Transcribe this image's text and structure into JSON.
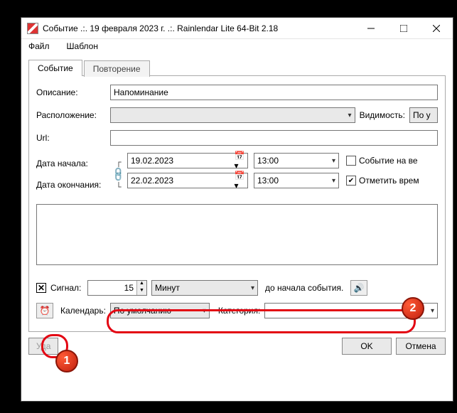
{
  "title": "Событие .:. 19 февраля 2023 г. .:. Rainlendar Lite 64-Bit 2.18",
  "menu": {
    "file": "Файл",
    "template": "Шаблон"
  },
  "tabs": {
    "event": "Событие",
    "recurrence": "Повторение"
  },
  "labels": {
    "description": "Описание:",
    "location": "Расположение:",
    "visibility": "Видимость:",
    "url": "Url:",
    "start": "Дата начала:",
    "end": "Дата окончания:",
    "allday": "Событие на ве",
    "markbusy": "Отметить врем",
    "alarm": "Сигнал:",
    "before": "до начала события.",
    "calendar": "Календарь:",
    "category": "Категория:"
  },
  "values": {
    "description": "Напоминание",
    "location": "",
    "visibility": "По у",
    "url": "",
    "start_date": "19.02.2023",
    "start_time": "13:00",
    "end_date": "22.02.2023",
    "end_time": "13:00",
    "allday_checked": false,
    "markbusy_checked": true,
    "alarm_value": "15",
    "alarm_unit": "Минут",
    "calendar": "По умолчанию",
    "category": "",
    "notes": ""
  },
  "buttons": {
    "delete": "Уда",
    "ok": "OK",
    "cancel": "Отмена"
  },
  "annotations": {
    "badge1": "1",
    "badge2": "2"
  }
}
